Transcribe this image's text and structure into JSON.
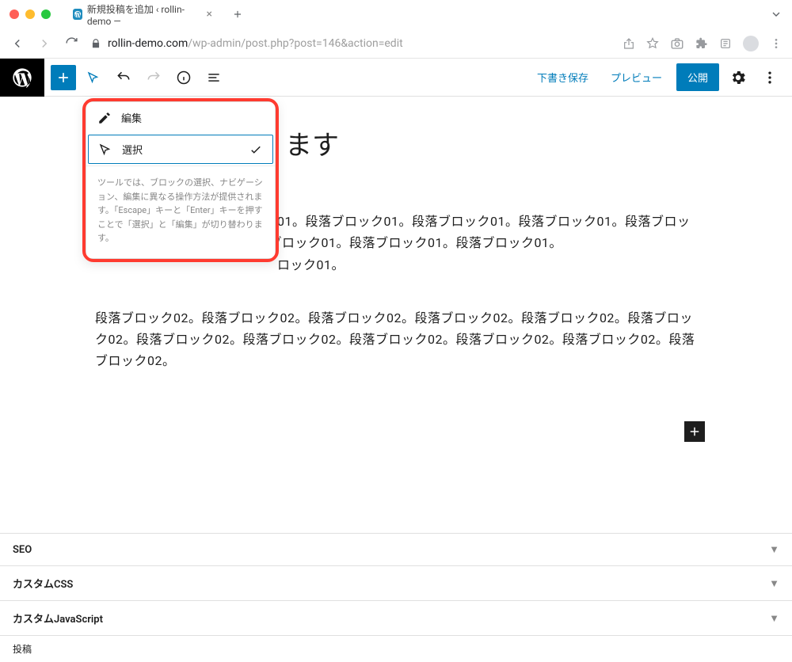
{
  "browser": {
    "tab_title": "新規投稿を追加 ‹ rollin-demo —",
    "url_host": "rollin-demo.com",
    "url_path": "/wp-admin/post.php?post=146&action=edit"
  },
  "toolbar": {
    "save_draft": "下書き保存",
    "preview": "プレビュー",
    "publish": "公開"
  },
  "popover": {
    "edit": "編集",
    "select": "選択",
    "description": "ツールでは、ブロックの選択、ナビゲーション、編集に異なる操作方法が提供されます。「Escape」キーと「Enter」キーを押すことで「選択」と「編集」が切り替わります。"
  },
  "post": {
    "title_visible": "ます",
    "paragraph1": "01。段落ブロック01。段落ブロック01。段落ブロック01。段落ブロック01。段落ブロック01。段落ブロック01。段落ブロック01。段落ブロック01。",
    "paragraph1_prefix": "ロック01。",
    "paragraph2": "段落ブロック02。段落ブロック02。段落ブロック02。段落ブロック02。段落ブロック02。段落ブロック02。段落ブロック02。段落ブロック02。段落ブロック02。段落ブロック02。段落ブロック02。段落ブロック02。"
  },
  "meta": {
    "seo": "SEO",
    "css": "カスタムCSS",
    "js": "カスタムJavaScript",
    "post": "投稿"
  }
}
